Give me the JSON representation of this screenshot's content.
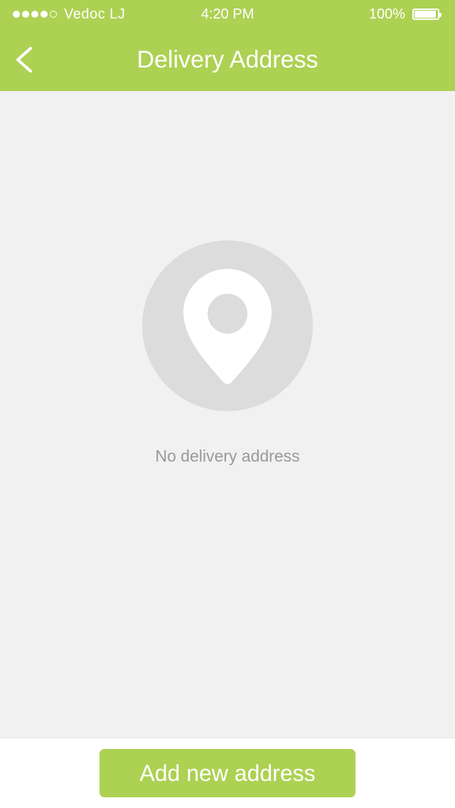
{
  "status_bar": {
    "carrier": "Vedoc LJ",
    "time": "4:20 PM",
    "battery_percent": "100%",
    "signal": {
      "filled_bars": 4,
      "total_bars": 5
    },
    "battery_level": 1.0
  },
  "header": {
    "back_icon": "chevron-left-icon",
    "title": "Delivery Address"
  },
  "empty_state": {
    "icon": "location-pin-icon",
    "message": "No delivery address"
  },
  "actions": {
    "add_address_label": "Add new address"
  },
  "colors": {
    "brand_green": "#add153",
    "background": "#f1f1f1",
    "icon_circle": "#dcdcdc",
    "muted_text": "#999999"
  }
}
